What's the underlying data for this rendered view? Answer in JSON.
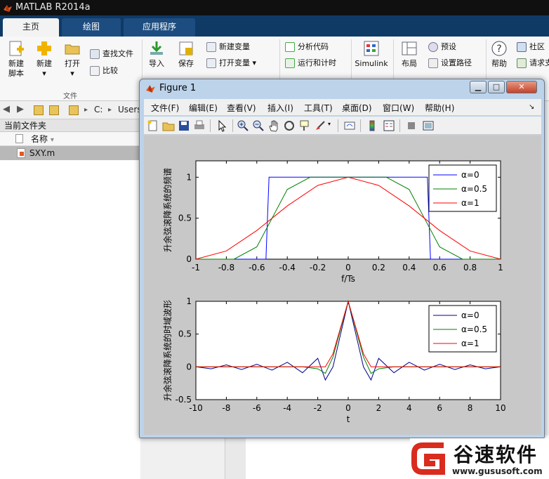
{
  "app": {
    "title": "MATLAB R2014a"
  },
  "tabs": [
    {
      "label": "主页",
      "active": true
    },
    {
      "label": "绘图",
      "active": false
    },
    {
      "label": "应用程序",
      "active": false
    }
  ],
  "ribbon": {
    "new_script": "新建\n脚本",
    "new_script_l1": "新建",
    "new_script_l2": "脚本",
    "new": "新建",
    "open": "打开",
    "find_files": "查找文件",
    "compare": "比较",
    "import_label": "导入",
    "save_label": "保存",
    "new_variable": "新建变量",
    "open_variable": "打开变量",
    "analyze_code": "分析代码",
    "run_and_time": "运行和计时",
    "simulink": "Simulink",
    "layout": "布局",
    "preferences": "预设",
    "set_path": "设置路径",
    "help": "帮助",
    "community": "社区",
    "request_support": "请求支",
    "group_file": "文件"
  },
  "address": {
    "path_c": "C:",
    "path_users": "Users"
  },
  "current_folder": {
    "header": "当前文件夹",
    "column_name": "名称",
    "files": [
      {
        "name": "SXY.m"
      }
    ]
  },
  "figure": {
    "title": "Figure 1",
    "menu": [
      "文件(F)",
      "编辑(E)",
      "查看(V)",
      "插入(I)",
      "工具(T)",
      "桌面(D)",
      "窗口(W)",
      "帮助(H)"
    ]
  },
  "chart_data": [
    {
      "type": "line",
      "ylabel": "升余弦滚降系统的频谱",
      "xlabel": "f/Ts",
      "xlim": [
        -1,
        1
      ],
      "ylim": [
        0,
        1.2
      ],
      "xticks": [
        -1,
        -0.8,
        -0.6,
        -0.4,
        -0.2,
        0,
        0.2,
        0.4,
        0.6,
        0.8,
        1
      ],
      "yticks": [
        0,
        0.5,
        1
      ],
      "legend_position": "top-right",
      "series": [
        {
          "name": "α=0",
          "color": "#0000ff",
          "x": [
            -1,
            -0.54,
            -0.52,
            0.52,
            0.54,
            1
          ],
          "y": [
            0,
            0,
            1,
            1,
            0,
            0
          ]
        },
        {
          "name": "α=0.5",
          "color": "#008000",
          "x": [
            -1,
            -0.75,
            -0.6,
            -0.5,
            -0.4,
            -0.25,
            0,
            0.25,
            0.4,
            0.5,
            0.6,
            0.75,
            1
          ],
          "y": [
            0,
            0,
            0.15,
            0.5,
            0.85,
            1,
            1,
            1,
            0.85,
            0.5,
            0.15,
            0,
            0
          ]
        },
        {
          "name": "α=1",
          "color": "#ff0000",
          "x": [
            -1,
            -0.8,
            -0.6,
            -0.4,
            -0.2,
            0,
            0.2,
            0.4,
            0.6,
            0.8,
            1
          ],
          "y": [
            0,
            0.1,
            0.35,
            0.65,
            0.9,
            1,
            0.9,
            0.65,
            0.35,
            0.1,
            0
          ]
        }
      ]
    },
    {
      "type": "line",
      "ylabel": "升余弦滚降系统的时域波形",
      "xlabel": "t",
      "xlim": [
        -10,
        10
      ],
      "ylim": [
        -0.5,
        1
      ],
      "xticks": [
        -10,
        -8,
        -6,
        -4,
        -2,
        0,
        2,
        4,
        6,
        8,
        10
      ],
      "yticks": [
        -0.5,
        0,
        0.5,
        1
      ],
      "legend_position": "top-right",
      "series": [
        {
          "name": "α=0",
          "color": "#00008b",
          "x": [
            -10,
            -9,
            -8,
            -7,
            -6,
            -5,
            -4,
            -3,
            -2,
            -1.5,
            -1,
            0,
            1,
            1.5,
            2,
            3,
            4,
            5,
            6,
            7,
            8,
            9,
            10
          ],
          "y": [
            0.0,
            -0.03,
            0.03,
            -0.04,
            0.04,
            -0.05,
            0.07,
            -0.09,
            0.13,
            -0.2,
            0.0,
            1,
            0.0,
            -0.2,
            0.13,
            -0.09,
            0.07,
            -0.05,
            0.04,
            -0.04,
            0.03,
            -0.03,
            0.0
          ]
        },
        {
          "name": "α=0.5",
          "color": "#008000",
          "x": [
            -10,
            -3,
            -2,
            -1.5,
            -1,
            0,
            1,
            1.5,
            2,
            3,
            10
          ],
          "y": [
            0,
            0,
            -0.03,
            -0.1,
            0.15,
            1,
            0.15,
            -0.1,
            -0.03,
            0,
            0
          ]
        },
        {
          "name": "α=1",
          "color": "#ff0000",
          "x": [
            -10,
            -2,
            -1.5,
            -1,
            0,
            1,
            1.5,
            2,
            10
          ],
          "y": [
            0,
            0,
            0.0,
            0.2,
            1,
            0.2,
            0.0,
            0,
            0
          ]
        }
      ]
    }
  ],
  "watermark": {
    "brand": "谷速软件",
    "url": "www.gususoft.com"
  }
}
